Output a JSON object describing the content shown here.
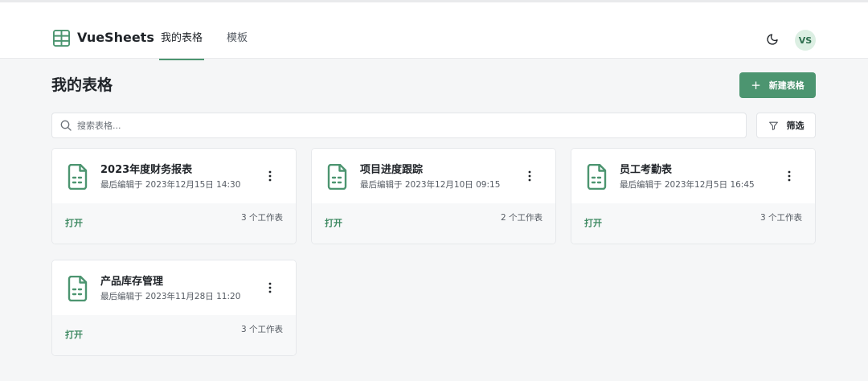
{
  "header": {
    "app_name": "VueSheets",
    "nav": [
      {
        "label": "我的表格",
        "active": true
      },
      {
        "label": "模板",
        "active": false
      }
    ],
    "theme_icon": "moon-icon",
    "avatar_initials": "VS"
  },
  "main": {
    "title": "我的表格",
    "new_button_label": "新建表格",
    "search_placeholder": "搜索表格...",
    "filter_label": "筛选"
  },
  "sheets": [
    {
      "title": "2023年度财务报表",
      "meta": "最后编辑于 2023年12月15日 14:30",
      "open_label": "打开",
      "count": "3 个工作表"
    },
    {
      "title": "项目进度跟踪",
      "meta": "最后编辑于 2023年12月10日 09:15",
      "open_label": "打开",
      "count": "2 个工作表"
    },
    {
      "title": "员工考勤表",
      "meta": "最后编辑于 2023年12月5日 16:45",
      "open_label": "打开",
      "count": "3 个工作表"
    },
    {
      "title": "产品库存管理",
      "meta": "最后编辑于 2023年11月28日 11:20",
      "open_label": "打开",
      "count": "3 个工作表"
    }
  ],
  "colors": {
    "accent": "#4c9570",
    "accent_text": "#3f8a63",
    "background": "#f5f6f7",
    "card": "#ffffff"
  }
}
